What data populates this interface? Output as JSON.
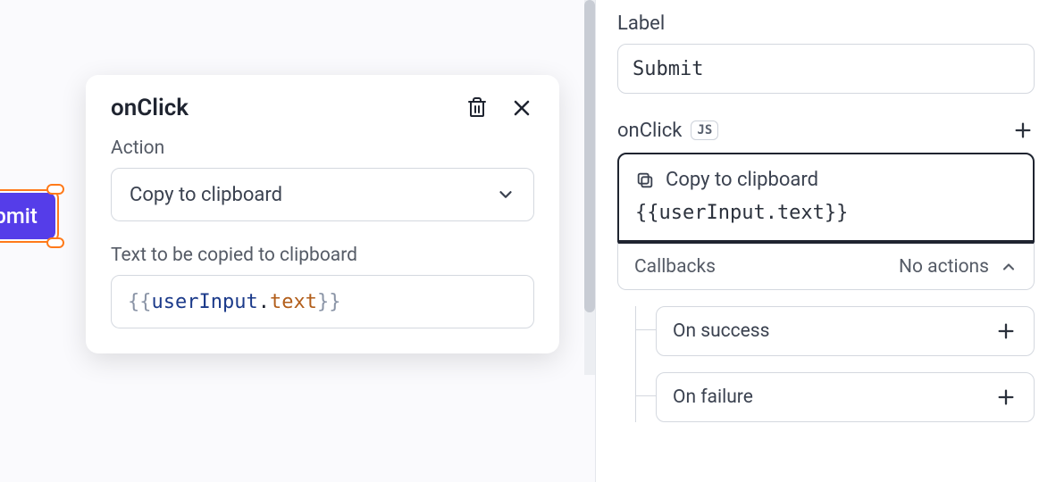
{
  "canvas": {
    "submit_button_label": "ubmit"
  },
  "popover": {
    "title": "onClick",
    "action_label": "Action",
    "action_value": "Copy to clipboard",
    "text_label": "Text to be copied to clipboard",
    "expr_open": "{{",
    "expr_obj": "userInput",
    "expr_dot": ".",
    "expr_prop": "text",
    "expr_close": "}}"
  },
  "panel": {
    "label_heading": "Label",
    "label_value": "Submit",
    "onclick_heading": "onClick",
    "js_badge": "JS",
    "action_card": {
      "name": "Copy to clipboard",
      "expression": "{{userInput.text}}"
    },
    "callbacks": {
      "title": "Callbacks",
      "status": "No actions",
      "items": [
        {
          "label": "On success"
        },
        {
          "label": "On failure"
        }
      ]
    }
  }
}
